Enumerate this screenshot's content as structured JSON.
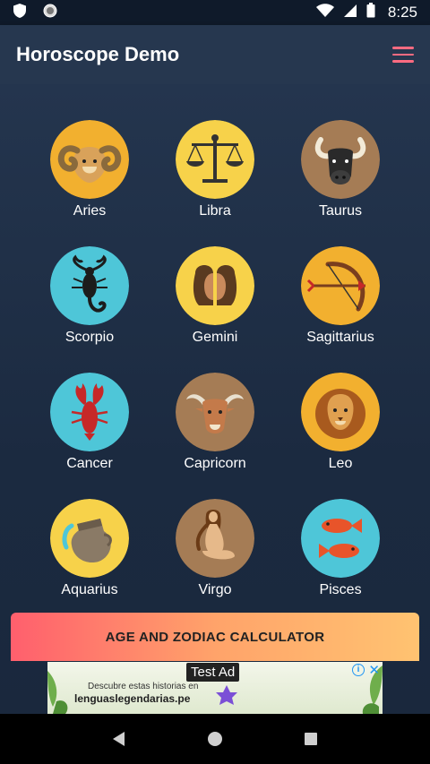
{
  "status_bar": {
    "time": "8:25",
    "icons": [
      "shield-icon",
      "circle-icon",
      "wifi-icon",
      "signal-icon",
      "battery-icon"
    ]
  },
  "app_bar": {
    "title": "Horoscope Demo",
    "menu_icon": "hamburger-menu-icon",
    "accent": "#ff6b81"
  },
  "signs": [
    {
      "label": "Aries",
      "icon": "ram-icon",
      "bg": "#f2b02f"
    },
    {
      "label": "Libra",
      "icon": "scales-icon",
      "bg": "#f7d24a"
    },
    {
      "label": "Taurus",
      "icon": "bull-icon",
      "bg": "#a57c55"
    },
    {
      "label": "Scorpio",
      "icon": "scorpion-icon",
      "bg": "#4ec6d8"
    },
    {
      "label": "Gemini",
      "icon": "twins-icon",
      "bg": "#f7d24a"
    },
    {
      "label": "Sagittarius",
      "icon": "bow-arrow-icon",
      "bg": "#f2b02f"
    },
    {
      "label": "Cancer",
      "icon": "crab-icon",
      "bg": "#4ec6d8"
    },
    {
      "label": "Capricorn",
      "icon": "goat-icon",
      "bg": "#a57c55"
    },
    {
      "label": "Leo",
      "icon": "lion-icon",
      "bg": "#f2b02f"
    },
    {
      "label": "Aquarius",
      "icon": "water-jar-icon",
      "bg": "#f7d24a"
    },
    {
      "label": "Virgo",
      "icon": "maiden-icon",
      "bg": "#a57c55"
    },
    {
      "label": "Pisces",
      "icon": "fish-icon",
      "bg": "#4ec6d8"
    }
  ],
  "calculator_button": {
    "label": "AGE AND ZODIAC CALCULATOR"
  },
  "ad": {
    "tag": "Test Ad",
    "line1": "Descubre estas historias en",
    "line2": "lenguaslegendarias.pe",
    "info_icon": "info-icon",
    "close_icon": "close-icon"
  },
  "nav_bar": {
    "icons": [
      "back-icon",
      "home-icon",
      "recents-icon"
    ]
  }
}
